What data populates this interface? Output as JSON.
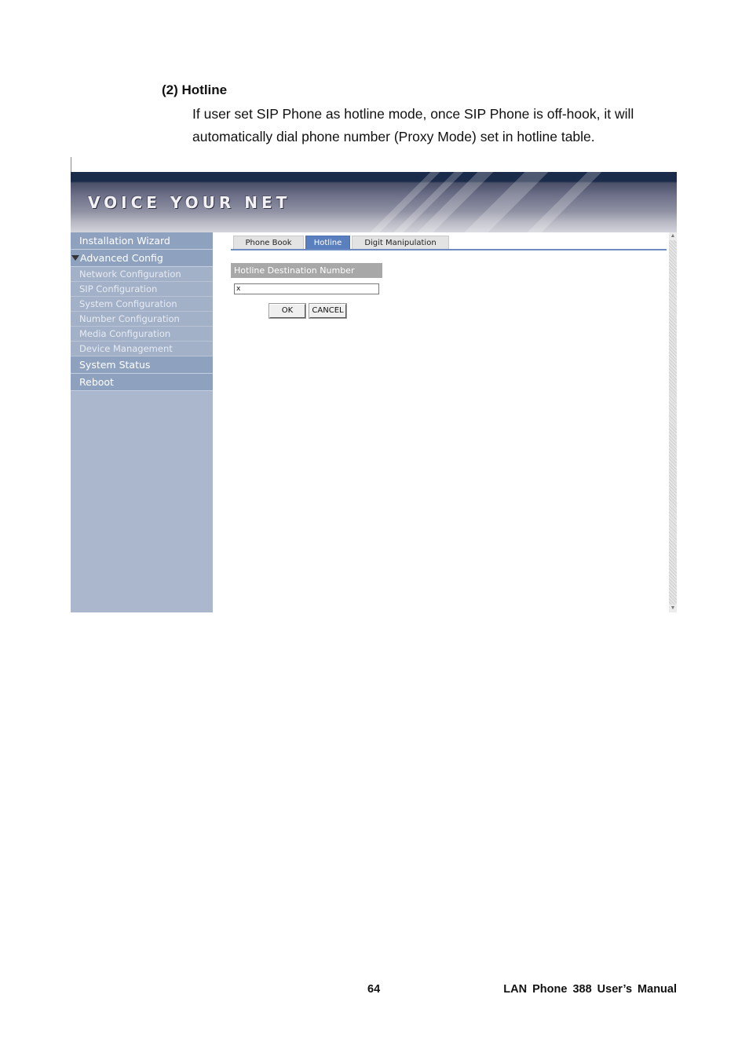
{
  "section": {
    "heading": "(2) Hotline",
    "paragraph": "If user set SIP Phone as hotline mode, once SIP Phone is off-hook, it will automatically dial phone number (Proxy Mode) set in hotline table."
  },
  "screenshot": {
    "logo": "VOICE YOUR NET",
    "sidebar": {
      "installation_wizard": "Installation Wizard",
      "advanced_config": "Advanced Config",
      "sub_items": [
        "Network Configuration",
        "SIP Configuration",
        "System Configuration",
        "Number Configuration",
        "Media Configuration",
        "Device Management"
      ],
      "system_status": "System Status",
      "reboot": "Reboot"
    },
    "tabs": [
      "Phone Book",
      "Hotline",
      "Digit Manipulation"
    ],
    "active_tab": "Hotline",
    "form": {
      "label": "Hotline Destination Number",
      "value": "x",
      "ok_label": "OK",
      "cancel_label": "CANCEL"
    },
    "colors": {
      "sidebar_bg": "#aab7cd",
      "nav_main_bg": "#8ea2c0",
      "active_tab_bg": "#5a7fbf"
    }
  },
  "footer": {
    "page_number": "64",
    "manual_title": "LAN Phone 388 User’s Manual"
  }
}
